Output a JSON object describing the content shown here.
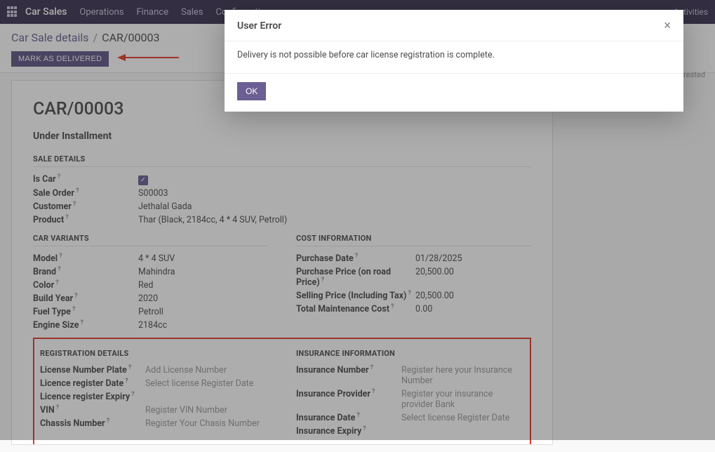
{
  "nav": {
    "brand": "Car Sales",
    "items": [
      "Operations",
      "Finance",
      "Sales",
      "Configuration"
    ],
    "activities": "Activities"
  },
  "breadcrumb": {
    "root": "Car Sale details",
    "sep": "/",
    "current": "CAR/00003"
  },
  "actions": {
    "mark_delivered": "MARK AS DELIVERED"
  },
  "sidebar": {
    "created_hint": "created"
  },
  "record": {
    "title": "CAR/00003",
    "status": "Under Installment"
  },
  "sections": {
    "sale_details": "SALE DETAILS",
    "car_variants": "CAR VARIANTS",
    "cost_information": "COST INFORMATION",
    "registration_details": "REGISTRATION DETAILS",
    "insurance_information": "INSURANCE INFORMATION"
  },
  "sale_details": {
    "is_car_label": "Is Car",
    "sale_order_label": "Sale Order",
    "sale_order": "S00003",
    "customer_label": "Customer",
    "customer": "Jethalal Gada",
    "product_label": "Product",
    "product": "Thar (Black, 2184cc, 4 * 4 SUV, Petroll)"
  },
  "car_variants": {
    "model_label": "Model",
    "model": "4 * 4 SUV",
    "brand_label": "Brand",
    "brand": "Mahindra",
    "color_label": "Color",
    "color": "Red",
    "build_year_label": "Build Year",
    "build_year": "2020",
    "fuel_type_label": "Fuel Type",
    "fuel_type": "Petroll",
    "engine_size_label": "Engine Size",
    "engine_size": "2184cc"
  },
  "cost_info": {
    "purchase_date_label": "Purchase Date",
    "purchase_date": "01/28/2025",
    "purchase_price_label": "Purchase Price (on road Price)",
    "purchase_price": "20,500.00",
    "selling_price_label": "Selling Price (Including Tax)",
    "selling_price": "20,500.00",
    "maintenance_label": "Total Maintenance Cost",
    "maintenance": "0.00"
  },
  "registration": {
    "license_plate_label": "License Number Plate",
    "license_plate_ph": "Add License Number",
    "reg_date_label": "Licence register Date",
    "reg_date_ph": "Select license Register Date",
    "reg_expiry_label": "Licence register Expiry",
    "vin_label": "VIN",
    "vin_ph": "Register VIN Number",
    "chassis_label": "Chassis Number",
    "chassis_ph": "Register Your Chasis Number"
  },
  "insurance": {
    "number_label": "Insurance Number",
    "number_ph": "Register here your Insurance Number",
    "provider_label": "Insurance Provider",
    "provider_ph": "Register your insurance provider Bank",
    "date_label": "Insurance Date",
    "date_ph": "Select license Register Date",
    "expiry_label": "Insurance Expiry"
  },
  "modal": {
    "title": "User Error",
    "message": "Delivery is not possible before car license registration is complete.",
    "ok": "OK"
  }
}
